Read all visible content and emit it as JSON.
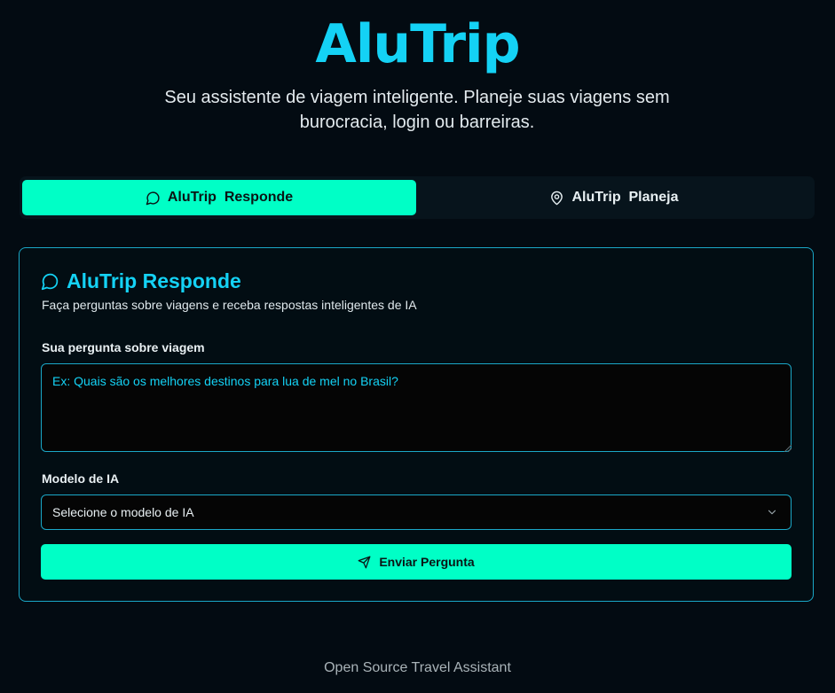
{
  "header": {
    "title": "AluTrip",
    "subtitle": "Seu assistente de viagem inteligente. Planeje suas viagens sem burocracia, login ou barreiras."
  },
  "tabs": [
    {
      "label": "AluTrip  Responde",
      "icon": "message-circle-icon",
      "active": true
    },
    {
      "label": "AluTrip  Planeja",
      "icon": "map-pin-icon",
      "active": false
    }
  ],
  "card": {
    "title": "AluTrip Responde",
    "icon": "message-circle-icon",
    "description": "Faça perguntas sobre viagens e receba respostas inteligentes de IA",
    "question": {
      "label": "Sua pergunta sobre viagem",
      "value": "",
      "placeholder": "Ex: Quais são os melhores destinos para lua de mel no Brasil?"
    },
    "model": {
      "label": "Modelo de IA",
      "selected": "Selecione o modelo de IA",
      "icon": "chevron-down-icon"
    },
    "submit": {
      "label": "Enviar Pergunta",
      "icon": "send-icon"
    }
  },
  "footer": {
    "text": "Open Source Travel Assistant"
  },
  "colors": {
    "background": "#030b12",
    "accent_cyan": "#14d2f5",
    "accent_mint": "#00ffc6",
    "border": "#1aa7c7"
  }
}
